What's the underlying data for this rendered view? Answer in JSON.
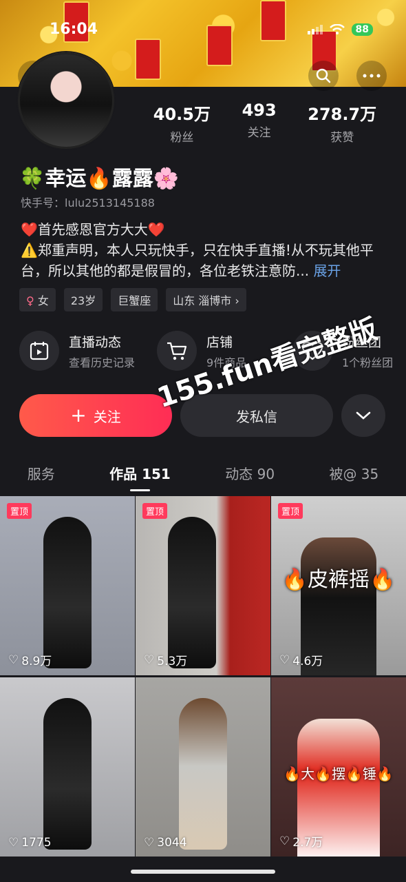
{
  "status": {
    "time": "16:04",
    "battery": "88"
  },
  "header": {
    "back_icon": "chevron-left-icon",
    "search_icon": "search-icon",
    "more_icon": "more-icon"
  },
  "profile": {
    "name": "🍀幸运🔥露露🌸",
    "uid": "快手号：lulu2513145188",
    "stats": [
      {
        "value": "40.5万",
        "label": "粉丝"
      },
      {
        "value": "493",
        "label": "关注"
      },
      {
        "value": "278.7万",
        "label": "获赞"
      }
    ],
    "bio_line1": "❤️首先感恩官方大大❤️",
    "bio_line2": "⚠️郑重声明，本人只玩快手，只在快手直播!从不玩其他平台，所以其他的都是假冒的，各位老铁注意防... ",
    "bio_more": "展开",
    "tags": [
      "女",
      "23岁",
      "巨蟹座",
      "山东 淄博市"
    ]
  },
  "features": [
    {
      "title": "直播动态",
      "sub": "查看历史记录",
      "icon": "calendar-play-icon"
    },
    {
      "title": "店铺",
      "sub": "9件商品",
      "icon": "cart-icon"
    },
    {
      "title": "粉丝团",
      "sub": "1个粉丝团",
      "icon": "heart-icon"
    }
  ],
  "actions": {
    "follow": "关注",
    "message": "发私信"
  },
  "watermark": "155.fun看完整版",
  "tabs": [
    "服务",
    "作品 151",
    "动态 90",
    "被@ 35"
  ],
  "pin_label": "置顶",
  "videos": [
    {
      "likes": "8.9万",
      "pinned": true,
      "overlay": ""
    },
    {
      "likes": "5.3万",
      "pinned": true,
      "overlay": ""
    },
    {
      "likes": "4.6万",
      "pinned": true,
      "overlay": "🔥皮裤摇🔥"
    },
    {
      "likes": "1775",
      "pinned": false,
      "overlay": ""
    },
    {
      "likes": "3044",
      "pinned": false,
      "overlay": ""
    },
    {
      "likes": "2.7万",
      "pinned": false,
      "overlay": "🔥大🔥摆🔥锤🔥"
    }
  ]
}
